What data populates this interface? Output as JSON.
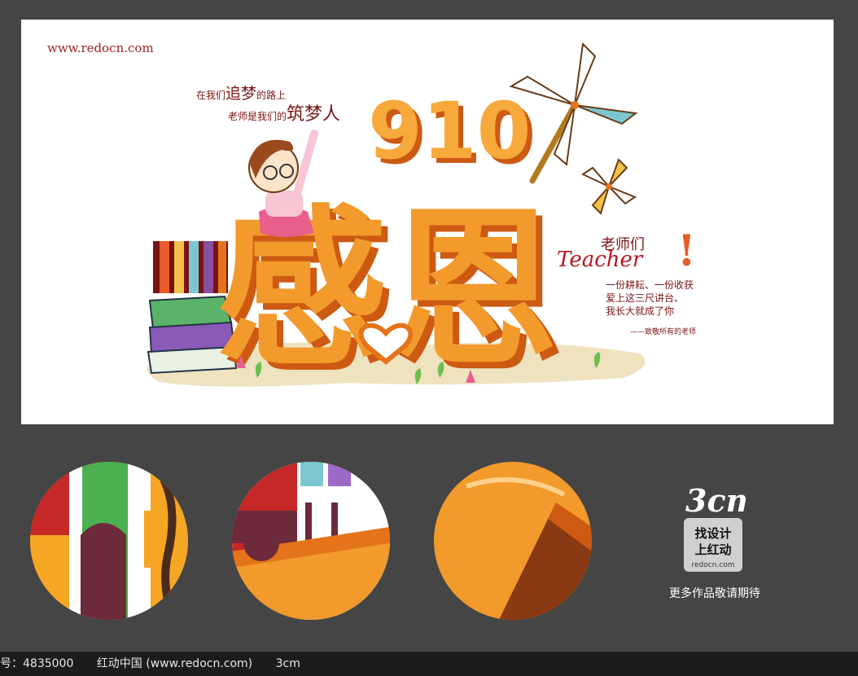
{
  "poster": {
    "site_url": "www.redocn.com",
    "slogan_line1_a": "在我们",
    "slogan_line1_b": "追梦",
    "slogan_line1_c": "的路上",
    "slogan_line2_a": "老师是我们的",
    "slogan_line2_b": "筑梦人",
    "title_glyphs": "感恩",
    "number_glyphs": "910",
    "teacher_cn": "老师们",
    "teacher_en": "Teacher",
    "exclaim": "!",
    "poem": [
      "一份耕耘、一份收获",
      "爱上这三尺讲台、",
      "我长大就成了你"
    ],
    "dedication": "——致敬所有的老师"
  },
  "badge": {
    "logo_mark": "3cm",
    "logo_line1": "找设计",
    "logo_line2": "上红动",
    "logo_url": "redocn.com",
    "more_works": "更多作品敬请期待"
  },
  "footer": {
    "id_label": "编号：",
    "id_value": "4835000",
    "site": "红动中国 (www.redocn.com)",
    "author": "3cm"
  },
  "colors": {
    "orange": "#f39a2c",
    "deep_orange": "#e4741c",
    "maroon": "#7a1414",
    "background": "#454545"
  }
}
